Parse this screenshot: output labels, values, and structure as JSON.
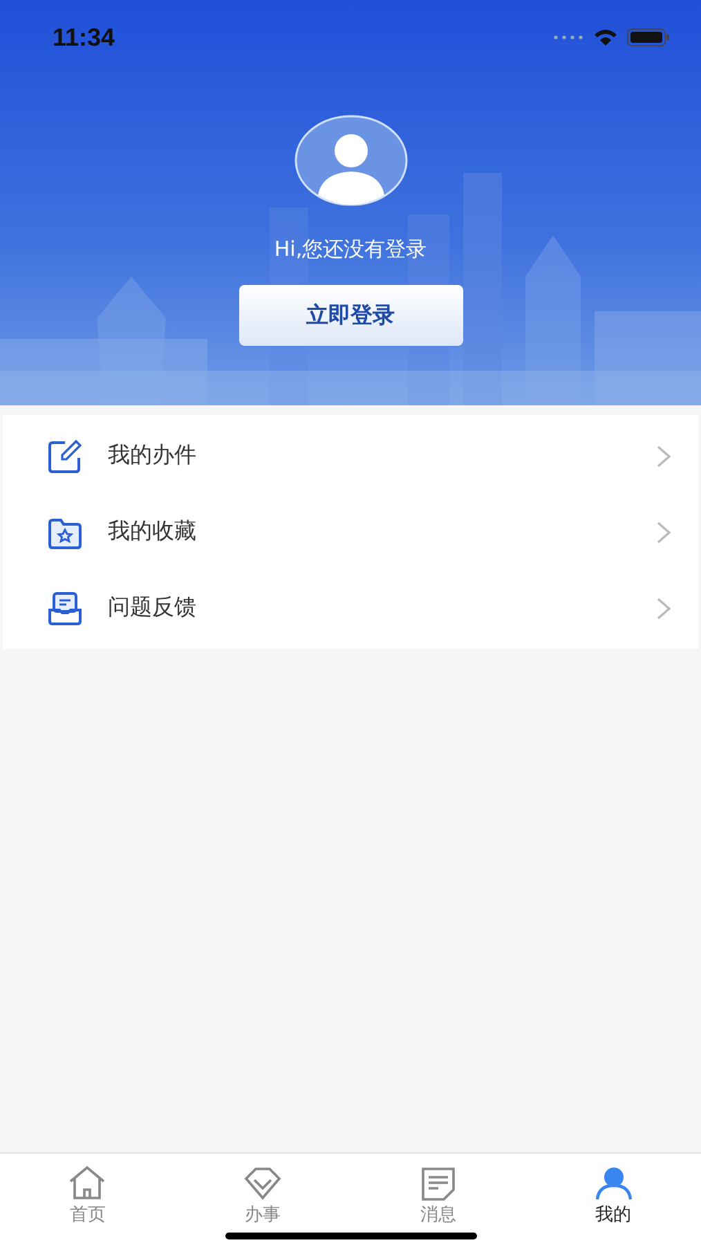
{
  "status_bar": {
    "time": "11:34"
  },
  "profile": {
    "greeting": "Hi,您还没有登录",
    "login_button": "立即登录"
  },
  "menu": [
    {
      "label": "我的办件",
      "kind": "edit"
    },
    {
      "label": "我的收藏",
      "kind": "star"
    },
    {
      "label": "问题反馈",
      "kind": "feedback"
    }
  ],
  "tabs": [
    {
      "label": "首页",
      "kind": "home",
      "selected": false
    },
    {
      "label": "办事",
      "kind": "diamond",
      "selected": false
    },
    {
      "label": "消息",
      "kind": "note",
      "selected": false
    },
    {
      "label": "我的",
      "kind": "person",
      "selected": true
    }
  ]
}
